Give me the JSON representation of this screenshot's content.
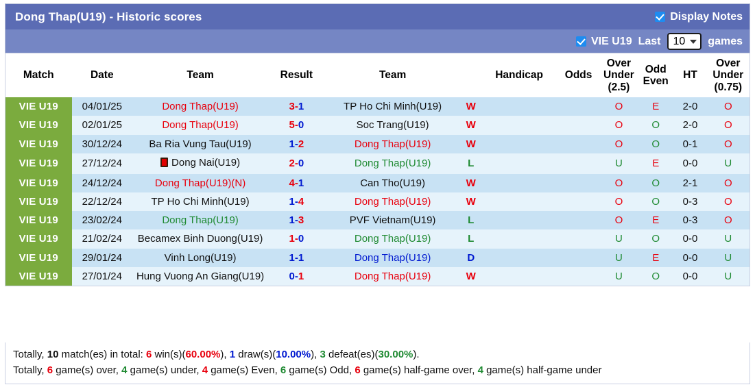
{
  "header": {
    "title": "Dong Thap(U19) - Historic scores",
    "display_notes_label": "Display Notes",
    "display_notes_checked": true,
    "league_filter_label": "VIE U19",
    "league_filter_checked": true,
    "last_label": "Last",
    "games_count": "10",
    "games_label": "games",
    "title_bar_color": "#5b6cb4",
    "sub_bar_color": "#7586c4"
  },
  "columns": {
    "match": "Match",
    "date": "Date",
    "team_home": "Team",
    "result": "Result",
    "team_away": "Team",
    "handicap": "Handicap",
    "odds": "Odds",
    "over_under": "Over\nUnder\n(2.5)",
    "over_under_l1": "Over",
    "over_under_l2": "Under",
    "over_under_l3": "(2.5)",
    "odd_even_l1": "Odd",
    "odd_even_l2": "Even",
    "ht": "HT",
    "over_under2_l1": "Over",
    "over_under2_l2": "Under",
    "over_under2_l3": "(0.75)"
  },
  "league_badge": "VIE U19",
  "rows": [
    {
      "league": "VIE U19",
      "date": "04/01/25",
      "home": "Dong Thap(U19)",
      "home_color": "red",
      "home_card": false,
      "score_home": "3",
      "score_away": "1",
      "score_home_color": "red",
      "score_away_color": "blue",
      "away": "TP Ho Chi Minh(U19)",
      "away_color": "dark",
      "away_card": false,
      "wl": "W",
      "wl_color": "red",
      "handicap": "",
      "odds": "",
      "ou": "O",
      "ou_color": "red",
      "oe": "E",
      "oe_color": "red",
      "ht": "2-0",
      "ou2": "O",
      "ou2_color": "red"
    },
    {
      "league": "VIE U19",
      "date": "02/01/25",
      "home": "Dong Thap(U19)",
      "home_color": "red",
      "home_card": false,
      "score_home": "5",
      "score_away": "0",
      "score_home_color": "red",
      "score_away_color": "blue",
      "away": "Soc Trang(U19)",
      "away_color": "dark",
      "away_card": false,
      "wl": "W",
      "wl_color": "red",
      "handicap": "",
      "odds": "",
      "ou": "O",
      "ou_color": "red",
      "oe": "O",
      "oe_color": "green",
      "ht": "2-0",
      "ou2": "O",
      "ou2_color": "red"
    },
    {
      "league": "VIE U19",
      "date": "30/12/24",
      "home": "Ba Ria Vung Tau(U19)",
      "home_color": "dark",
      "home_card": false,
      "score_home": "1",
      "score_away": "2",
      "score_home_color": "blue",
      "score_away_color": "red",
      "away": "Dong Thap(U19)",
      "away_color": "red",
      "away_card": false,
      "wl": "W",
      "wl_color": "red",
      "handicap": "",
      "odds": "",
      "ou": "O",
      "ou_color": "red",
      "oe": "O",
      "oe_color": "green",
      "ht": "0-1",
      "ou2": "O",
      "ou2_color": "red"
    },
    {
      "league": "VIE U19",
      "date": "27/12/24",
      "home": "Dong Nai(U19)",
      "home_color": "dark",
      "home_card": true,
      "score_home": "2",
      "score_away": "0",
      "score_home_color": "red",
      "score_away_color": "blue",
      "away": "Dong Thap(U19)",
      "away_color": "green",
      "away_card": false,
      "wl": "L",
      "wl_color": "green",
      "handicap": "",
      "odds": "",
      "ou": "U",
      "ou_color": "green",
      "oe": "E",
      "oe_color": "red",
      "ht": "0-0",
      "ou2": "U",
      "ou2_color": "green"
    },
    {
      "league": "VIE U19",
      "date": "24/12/24",
      "home": "Dong Thap(U19)(N)",
      "home_color": "red",
      "home_card": false,
      "score_home": "4",
      "score_away": "1",
      "score_home_color": "red",
      "score_away_color": "blue",
      "away": "Can Tho(U19)",
      "away_color": "dark",
      "away_card": false,
      "wl": "W",
      "wl_color": "red",
      "handicap": "",
      "odds": "",
      "ou": "O",
      "ou_color": "red",
      "oe": "O",
      "oe_color": "green",
      "ht": "2-1",
      "ou2": "O",
      "ou2_color": "red"
    },
    {
      "league": "VIE U19",
      "date": "22/12/24",
      "home": "TP Ho Chi Minh(U19)",
      "home_color": "dark",
      "home_card": false,
      "score_home": "1",
      "score_away": "4",
      "score_home_color": "blue",
      "score_away_color": "red",
      "away": "Dong Thap(U19)",
      "away_color": "red",
      "away_card": false,
      "wl": "W",
      "wl_color": "red",
      "handicap": "",
      "odds": "",
      "ou": "O",
      "ou_color": "red",
      "oe": "O",
      "oe_color": "green",
      "ht": "0-3",
      "ou2": "O",
      "ou2_color": "red"
    },
    {
      "league": "VIE U19",
      "date": "23/02/24",
      "home": "Dong Thap(U19)",
      "home_color": "green",
      "home_card": false,
      "score_home": "1",
      "score_away": "3",
      "score_home_color": "blue",
      "score_away_color": "red",
      "away": "PVF Vietnam(U19)",
      "away_color": "dark",
      "away_card": false,
      "wl": "L",
      "wl_color": "green",
      "handicap": "",
      "odds": "",
      "ou": "O",
      "ou_color": "red",
      "oe": "E",
      "oe_color": "red",
      "ht": "0-3",
      "ou2": "O",
      "ou2_color": "red"
    },
    {
      "league": "VIE U19",
      "date": "21/02/24",
      "home": "Becamex Binh Duong(U19)",
      "home_color": "dark",
      "home_card": false,
      "score_home": "1",
      "score_away": "0",
      "score_home_color": "red",
      "score_away_color": "blue",
      "away": "Dong Thap(U19)",
      "away_color": "green",
      "away_card": false,
      "wl": "L",
      "wl_color": "green",
      "handicap": "",
      "odds": "",
      "ou": "U",
      "ou_color": "green",
      "oe": "O",
      "oe_color": "green",
      "ht": "0-0",
      "ou2": "U",
      "ou2_color": "green"
    },
    {
      "league": "VIE U19",
      "date": "29/01/24",
      "home": "Vinh Long(U19)",
      "home_color": "dark",
      "home_card": false,
      "score_home": "1",
      "score_away": "1",
      "score_home_color": "blue",
      "score_away_color": "blue",
      "away": "Dong Thap(U19)",
      "away_color": "blue",
      "away_card": false,
      "wl": "D",
      "wl_color": "blue",
      "handicap": "",
      "odds": "",
      "ou": "U",
      "ou_color": "green",
      "oe": "E",
      "oe_color": "red",
      "ht": "0-0",
      "ou2": "U",
      "ou2_color": "green"
    },
    {
      "league": "VIE U19",
      "date": "27/01/24",
      "home": "Hung Vuong An Giang(U19)",
      "home_color": "dark",
      "home_card": false,
      "score_home": "0",
      "score_away": "1",
      "score_home_color": "blue",
      "score_away_color": "red",
      "away": "Dong Thap(U19)",
      "away_color": "red",
      "away_card": false,
      "wl": "W",
      "wl_color": "red",
      "handicap": "",
      "odds": "",
      "ou": "U",
      "ou_color": "green",
      "oe": "O",
      "oe_color": "green",
      "ht": "0-0",
      "ou2": "U",
      "ou2_color": "green"
    }
  ],
  "summary": {
    "line1": {
      "t1": "Totally, ",
      "total": "10",
      "t2": " match(es) in total: ",
      "wins": "6",
      "t3": " win(s)(",
      "win_pct": "60.00%",
      "t4": "), ",
      "draws": "1",
      "t5": " draw(s)(",
      "draw_pct": "10.00%",
      "t6": "), ",
      "defeats": "3",
      "t7": " defeat(es)(",
      "defeat_pct": "30.00%",
      "t8": ")."
    },
    "line2": {
      "t1": "Totally, ",
      "over": "6",
      "t2": " game(s) over, ",
      "under": "4",
      "t3": " game(s) under, ",
      "even": "4",
      "t4": " game(s) Even, ",
      "odd": "6",
      "t5": " game(s) Odd, ",
      "half_over": "6",
      "t6": " game(s) half-game over, ",
      "half_under": "4",
      "t7": " game(s) half-game under"
    }
  },
  "colors": {
    "league_green": "#7bab3e",
    "row_odd": "#c8e2f4",
    "row_even": "#e6f3fb",
    "red": "#e8000d",
    "blue": "#0019d0",
    "green": "#1f8a32"
  }
}
